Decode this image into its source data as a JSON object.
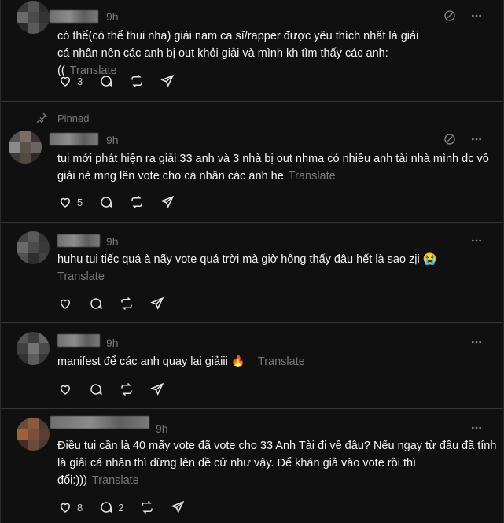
{
  "posts": [
    {
      "time": "9h",
      "text": "có thể(có thể thui nha) giải nam ca sĩ/rapper được yêu thích nhất là giải cá nhân nên các anh bị out khỏi giải và mình kh tìm thấy các anh:((",
      "translate": "Translate",
      "likes": "3",
      "replies": ""
    },
    {
      "pinned_label": "Pinned",
      "time": "9h",
      "text": "tui mới phát hiện ra giải 33 anh và 3 nhà bị out nhma có nhiều anh tài nhà mình dc vô giải nè mng lên vote cho cá nhân các anh he",
      "translate": "Translate",
      "likes": "5",
      "replies": ""
    },
    {
      "time": "9h",
      "text": "huhu tui tiếc quá à nãy vote quá trời mà giờ hông thấy đâu hết là sao zịi 😭",
      "translate": "Translate",
      "likes": "",
      "replies": ""
    },
    {
      "time": "9h",
      "text": "manifest để các anh quay lại giảiii 🔥",
      "translate": "Translate",
      "likes": "",
      "replies": ""
    },
    {
      "time": "9h",
      "text": "Điều tui cần là 40 mấy vote đã vote cho 33 Anh Tài đi về đâu? Nếu ngay từ đầu đã tính là giải cá nhân thì đừng lên đề cử như vậy. Để khán giả vào vote rồi thì đổi:)))",
      "translate": "Translate",
      "likes": "8",
      "replies": "2"
    }
  ],
  "icons": {
    "top": [
      "quote-edit-icon",
      "more-icon"
    ],
    "actions": [
      "heart-icon",
      "comment-icon",
      "repost-icon",
      "share-icon"
    ],
    "pin": "pin-icon"
  }
}
